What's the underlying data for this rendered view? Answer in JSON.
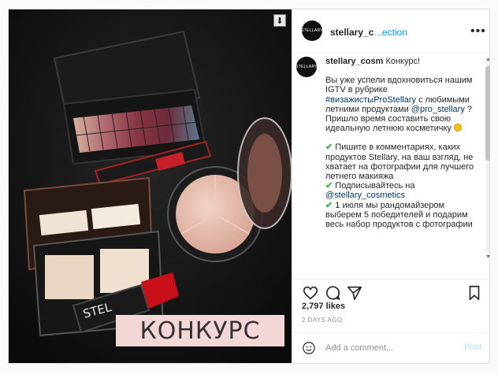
{
  "post": {
    "image": {
      "download_icon": "download-icon",
      "overlay_text": "КОНКУРС",
      "brand_text": "STEL"
    },
    "header": {
      "username": "stellary_c",
      "follow_text": "...ection",
      "avatar_text": "STELLARY",
      "more_icon": "more-icon"
    },
    "caption": {
      "username": "stellary_cosm",
      "lines": [
        {
          "before": "",
          "highlight": "",
          "after": " Конкурс!"
        },
        {
          "before": "",
          "highlight": "",
          "after": ""
        },
        {
          "before": "Вы уже успели вдохновиться нашим IGTV в рубрике ",
          "highlight": "#визажистыProStellary",
          "after": " с любимыми летними продуктами "
        },
        {
          "before": "",
          "highlight": "@pro_stellary",
          "after": " ? Пришло время составить свою идеальную летнюю косметичку"
        }
      ],
      "bullets": [
        "Пишите в комментариях, каких продуктов Stellary, на ваш взгляд, не хватает на фотографии для лучшего летнего макияжа",
        "Подписывайтесь на",
        "1 июля мы рандомайзером выберем 5 победителей и подарим весь набор продуктов с фотографии"
      ],
      "follow_link": "@stellary_cosmetics"
    },
    "likes": "2,797 likes",
    "date": "2 DAYS AGO",
    "comment": {
      "placeholder": "Add a comment...",
      "value": "",
      "post_label": "Post"
    },
    "colors": {
      "link": "#00376b",
      "button": "#0095f6",
      "check": "#3fb24a",
      "border": "#dbdbdb"
    }
  }
}
